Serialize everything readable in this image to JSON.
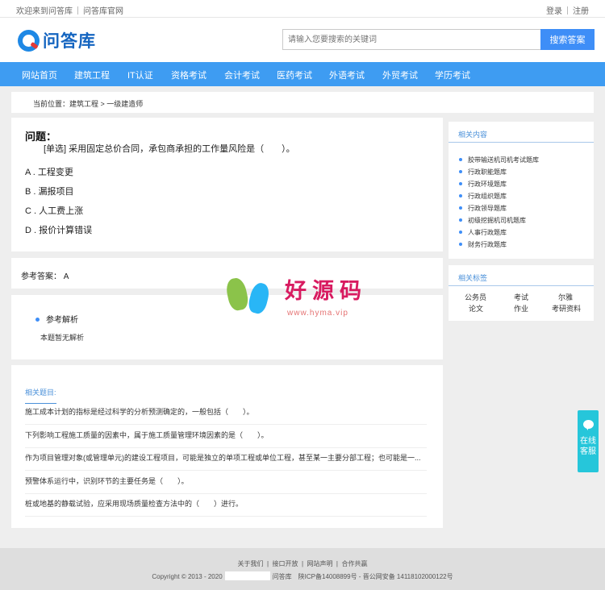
{
  "topbar": {
    "welcome": "欢迎来到问答库",
    "official": "问答库官网",
    "login": "登录",
    "register": "注册"
  },
  "header": {
    "logo_text": "问答库",
    "search_placeholder": "请输入您要搜索的关键词",
    "search_button": "搜索答案"
  },
  "nav": [
    "网站首页",
    "建筑工程",
    "IT认证",
    "资格考试",
    "会计考试",
    "医药考试",
    "外语考试",
    "外贸考试",
    "学历考试"
  ],
  "breadcrumb": "当前位置：建筑工程 > 一级建造师",
  "question": {
    "title": "问题：",
    "stem": "[单选] 采用固定总价合同，承包商承担的工作量风险是（　　）。",
    "options": [
      "A . 工程变更",
      "B . 漏报项目",
      "C . 人工费上涨",
      "D . 报价计算错误"
    ]
  },
  "answer": "参考答案： A",
  "analysis": {
    "title": "参考解析",
    "text": "本题暂无解析"
  },
  "related": {
    "heading": "相关题目:",
    "items": [
      "施工成本计划的指标是经过科学的分析预测确定的，一般包括（　　）。",
      "下列影响工程施工质量的因素中，属于施工质量管理环境因素的是（　　）。",
      "作为项目管理对象(或管理单元)的建设工程项目，可能是独立的单项工程或单位工程，甚至某一主要分部工程；也可能是一...",
      "预警体系运行中，识别环节的主要任务是（　　）。",
      "桩或地基的静载试验，应采用现场质量检查方法中的（　　）进行。"
    ]
  },
  "sidebar": {
    "related_content": {
      "heading": "相关内容",
      "items": [
        "胶带输送机司机考试题库",
        "行政职能题库",
        "行政环境题库",
        "行政组织题库",
        "行政领导题库",
        "初级挖掘机司机题库",
        "人事行政题库",
        "财务行政题库"
      ]
    },
    "tags": {
      "heading": "相关标签",
      "items": [
        "公务员",
        "考试",
        "尔雅",
        "论文",
        "作业",
        "考研资料"
      ]
    }
  },
  "watermark": {
    "text": "好源码",
    "url": "www.hyma.vip"
  },
  "float_service": "在线客服",
  "footer": {
    "links": [
      "关于我们",
      "接口开放",
      "网站声明",
      "合作共赢"
    ],
    "copyright_prefix": "Copyright © 2013 - 2020",
    "copyright_suffix": "问答库　陕ICP备14008899号 - 晋公网安备 14118102000122号"
  },
  "colors": {
    "nav": "#3e9cf2",
    "brand": "#1565c0",
    "accent": "#3e8ef7"
  }
}
